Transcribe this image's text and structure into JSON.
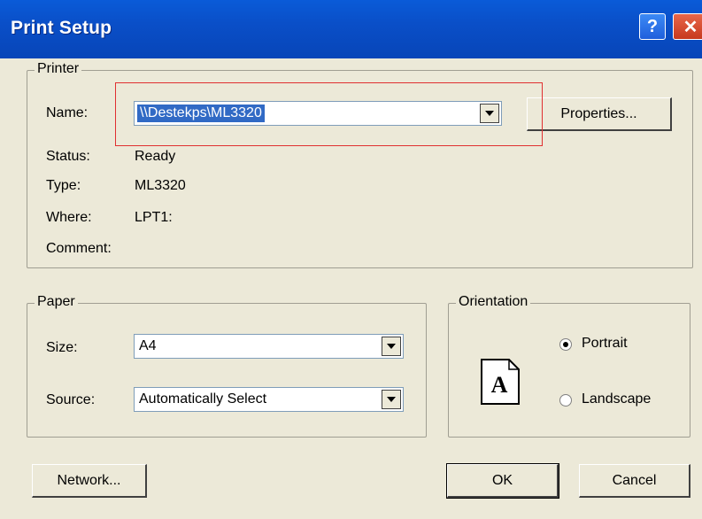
{
  "title": "Print Setup",
  "titlebar": {
    "help_label": "?",
    "close_label": "✕"
  },
  "printer": {
    "legend": "Printer",
    "name_label": "Name:",
    "name_value": "\\\\Destekps\\ML3320",
    "properties_label": "Properties...",
    "status_label": "Status:",
    "status_value": "Ready",
    "type_label": "Type:",
    "type_value": "ML3320",
    "where_label": "Where:",
    "where_value": "LPT1:",
    "comment_label": "Comment:",
    "comment_value": ""
  },
  "paper": {
    "legend": "Paper",
    "size_label": "Size:",
    "size_value": "A4",
    "source_label": "Source:",
    "source_value": "Automatically Select"
  },
  "orientation": {
    "legend": "Orientation",
    "page_glyph": "A",
    "portrait_label": "Portrait",
    "landscape_label": "Landscape",
    "selected": "portrait"
  },
  "buttons": {
    "network": "Network...",
    "ok": "OK",
    "cancel": "Cancel"
  }
}
